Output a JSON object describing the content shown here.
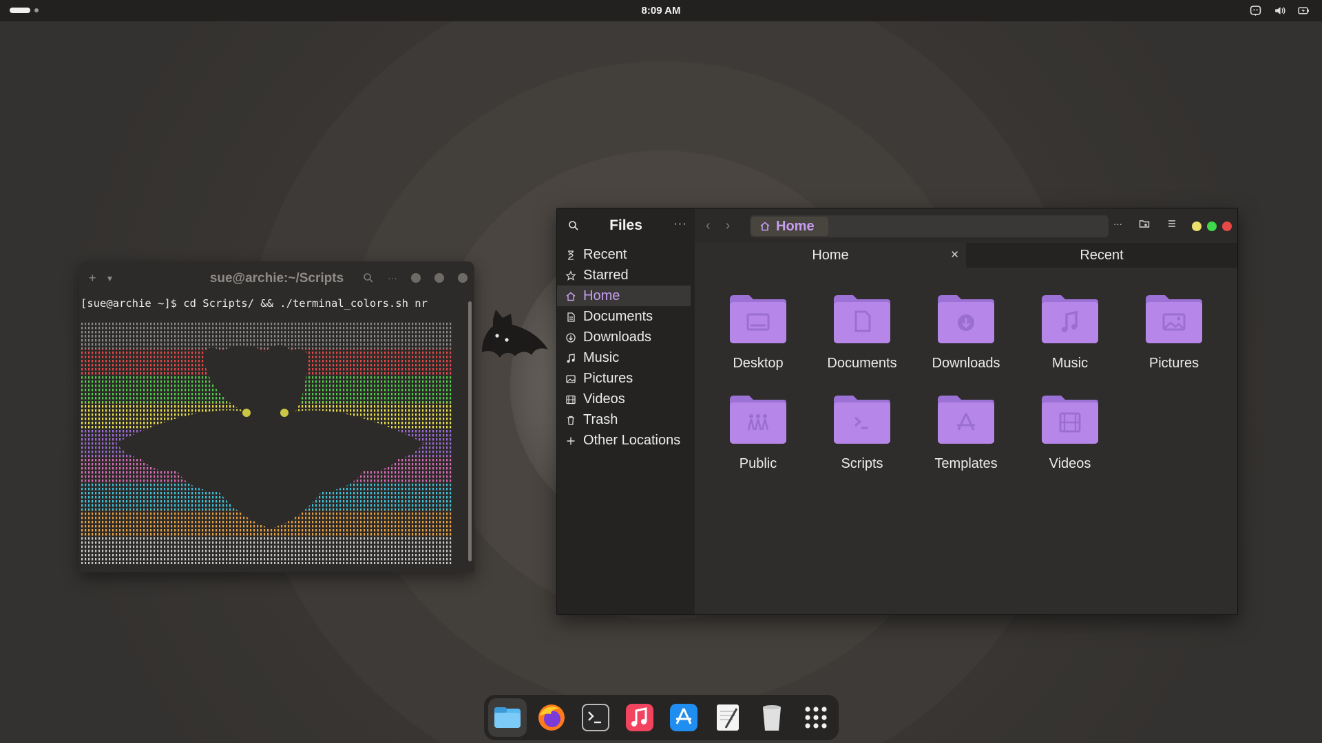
{
  "topbar": {
    "clock": "8:09 AM",
    "tray_icons": [
      "accessibility-icon",
      "volume-icon",
      "battery-icon"
    ]
  },
  "terminal": {
    "title": "sue@archie:~/Scripts",
    "prompt": "[sue@archie ~]$ cd Scripts/ && ./terminal_colors.sh nr",
    "art_colors": [
      "#8a8a8a",
      "#e04848",
      "#4fcf4a",
      "#e8e04a",
      "#9d6bd8",
      "#d86bb8",
      "#3fc0d8",
      "#e8a040",
      "#c8c8c8"
    ]
  },
  "files": {
    "app_title": "Files",
    "more_label": "···",
    "sidebar": [
      {
        "label": "Recent",
        "icon": "recent-icon"
      },
      {
        "label": "Starred",
        "icon": "star-icon"
      },
      {
        "label": "Home",
        "icon": "home-icon",
        "active": true
      },
      {
        "label": "Documents",
        "icon": "documents-icon"
      },
      {
        "label": "Downloads",
        "icon": "downloads-icon"
      },
      {
        "label": "Music",
        "icon": "music-icon"
      },
      {
        "label": "Pictures",
        "icon": "pictures-icon"
      },
      {
        "label": "Videos",
        "icon": "videos-icon"
      },
      {
        "label": "Trash",
        "icon": "trash-icon"
      },
      {
        "label": "Other Locations",
        "icon": "plus-icon"
      }
    ],
    "path": "Home",
    "tabs": [
      {
        "label": "Home",
        "active": true
      },
      {
        "label": "Recent",
        "active": false
      }
    ],
    "folders": [
      {
        "label": "Desktop",
        "glyph": "desktop"
      },
      {
        "label": "Documents",
        "glyph": "document"
      },
      {
        "label": "Downloads",
        "glyph": "download"
      },
      {
        "label": "Music",
        "glyph": "music"
      },
      {
        "label": "Pictures",
        "glyph": "picture"
      },
      {
        "label": "Public",
        "glyph": "public"
      },
      {
        "label": "Scripts",
        "glyph": "script"
      },
      {
        "label": "Templates",
        "glyph": "template"
      },
      {
        "label": "Videos",
        "glyph": "video"
      }
    ],
    "accent": "#c59df0",
    "folder_color": "#b687e8",
    "window_controls": [
      "#e8e06a",
      "#3ed84a",
      "#e84848"
    ]
  },
  "dock": {
    "items": [
      "files-app-icon",
      "firefox-icon",
      "terminal-app-icon",
      "music-app-icon",
      "app-store-icon",
      "text-editor-icon",
      "trash-app-icon",
      "app-grid-icon"
    ]
  }
}
